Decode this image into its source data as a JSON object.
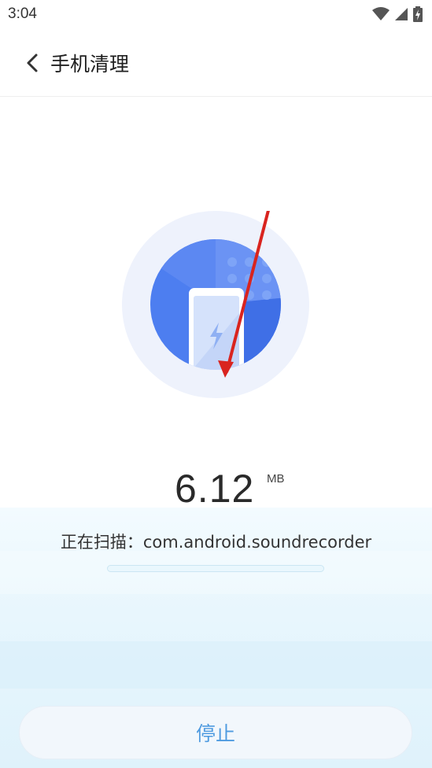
{
  "status_bar": {
    "time": "3:04",
    "icons": [
      "wifi-icon",
      "signal-icon",
      "battery-charging-icon"
    ]
  },
  "header": {
    "title": "手机清理",
    "back_icon": "chevron-left-icon"
  },
  "scan": {
    "size_value": "6.12",
    "size_unit": "MB",
    "scanning_text": "正在扫描：com.android.soundrecorder",
    "progress": 0.0
  },
  "actions": {
    "stop_label": "停止"
  },
  "colors": {
    "accent": "#4f9be0",
    "circle_outer": "#eef2fc",
    "circle_inner": "#4d7ef0",
    "annotation_arrow": "#d9241f"
  }
}
